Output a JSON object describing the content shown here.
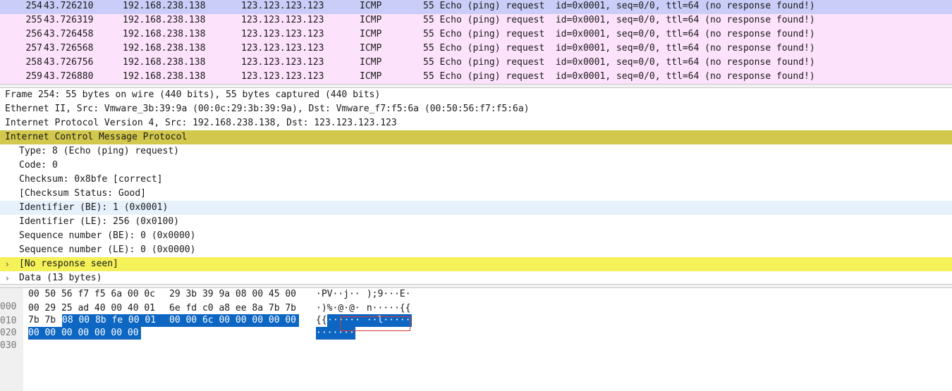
{
  "packet_list": {
    "rows": [
      {
        "no": "254",
        "time": "43.726210",
        "src": "192.168.238.138",
        "dst": "123.123.123.123",
        "proto": "ICMP",
        "info": "55 Echo (ping) request  id=0x0001, seq=0/0, ttl=64 (no response found!)",
        "selected": true
      },
      {
        "no": "255",
        "time": "43.726319",
        "src": "192.168.238.138",
        "dst": "123.123.123.123",
        "proto": "ICMP",
        "info": "55 Echo (ping) request  id=0x0001, seq=0/0, ttl=64 (no response found!)"
      },
      {
        "no": "256",
        "time": "43.726458",
        "src": "192.168.238.138",
        "dst": "123.123.123.123",
        "proto": "ICMP",
        "info": "55 Echo (ping) request  id=0x0001, seq=0/0, ttl=64 (no response found!)"
      },
      {
        "no": "257",
        "time": "43.726568",
        "src": "192.168.238.138",
        "dst": "123.123.123.123",
        "proto": "ICMP",
        "info": "55 Echo (ping) request  id=0x0001, seq=0/0, ttl=64 (no response found!)"
      },
      {
        "no": "258",
        "time": "43.726756",
        "src": "192.168.238.138",
        "dst": "123.123.123.123",
        "proto": "ICMP",
        "info": "55 Echo (ping) request  id=0x0001, seq=0/0, ttl=64 (no response found!)"
      },
      {
        "no": "259",
        "time": "43.726880",
        "src": "192.168.238.138",
        "dst": "123.123.123.123",
        "proto": "ICMP",
        "info": "55 Echo (ping) request  id=0x0001, seq=0/0, ttl=64 (no response found!)"
      }
    ]
  },
  "details": {
    "frame": "Frame 254: 55 bytes on wire (440 bits), 55 bytes captured (440 bits)",
    "ethernet": "Ethernet II, Src: Vmware_3b:39:9a (00:0c:29:3b:39:9a), Dst: Vmware_f7:f5:6a (00:50:56:f7:f5:6a)",
    "ip": "Internet Protocol Version 4, Src: 192.168.238.138, Dst: 123.123.123.123",
    "icmp": "Internet Control Message Protocol",
    "type": "Type: 8 (Echo (ping) request)",
    "code": "Code: 0",
    "checksum": "Checksum: 0x8bfe [correct]",
    "checksum_status": "[Checksum Status: Good]",
    "identifier_be": "Identifier (BE): 1 (0x0001)",
    "identifier_le": "Identifier (LE): 256 (0x0100)",
    "seq_be": "Sequence number (BE): 0 (0x0000)",
    "seq_le": "Sequence number (LE): 0 (0x0000)",
    "no_response": "[No response seen]",
    "data": "Data (13 bytes)"
  },
  "bytes": {
    "r0": {
      "offset": "000",
      "hex_a": "00 50 56 f7 f5 6a 00 0c",
      "hex_b": "29 3b 39 9a 08 00 45 00",
      "ascii_a": "·PV··j··",
      "ascii_b": " );9···E·"
    },
    "r1": {
      "offset": "010",
      "hex_a": "00 29 25 ad 40 00 40 01",
      "hex_b": "6e fd c0 a8 ee 8a 7b 7b",
      "ascii_a": "·)%·@·@·",
      "ascii_b": " n·····{{"
    },
    "r2": {
      "offset": "020",
      "hex_pre": "7b 7b",
      "hex_sel_a": "08 00 8b fe 00 01",
      "hex_sel_b": "00 00 6c 00 00 00 00 00",
      "ascii_pre": "{{",
      "ascii_sel_a": "······",
      "ascii_sel_b": " ··l·····"
    },
    "r3": {
      "offset": "030",
      "hex_sel": "00 00 00 00 00 00 00",
      "ascii_sel": "·······"
    }
  },
  "colors": {
    "row_bg": "#fde2fb",
    "row_selected": "#c9cdf7",
    "icmp_highlight": "#d2c84d",
    "warning_highlight": "#f5f158",
    "field_selected": "#e6f1fc",
    "byte_selection": "#0c66c2",
    "annotation_box": "#d23b3b"
  },
  "icons": {
    "expand": "chevron-right-icon"
  }
}
